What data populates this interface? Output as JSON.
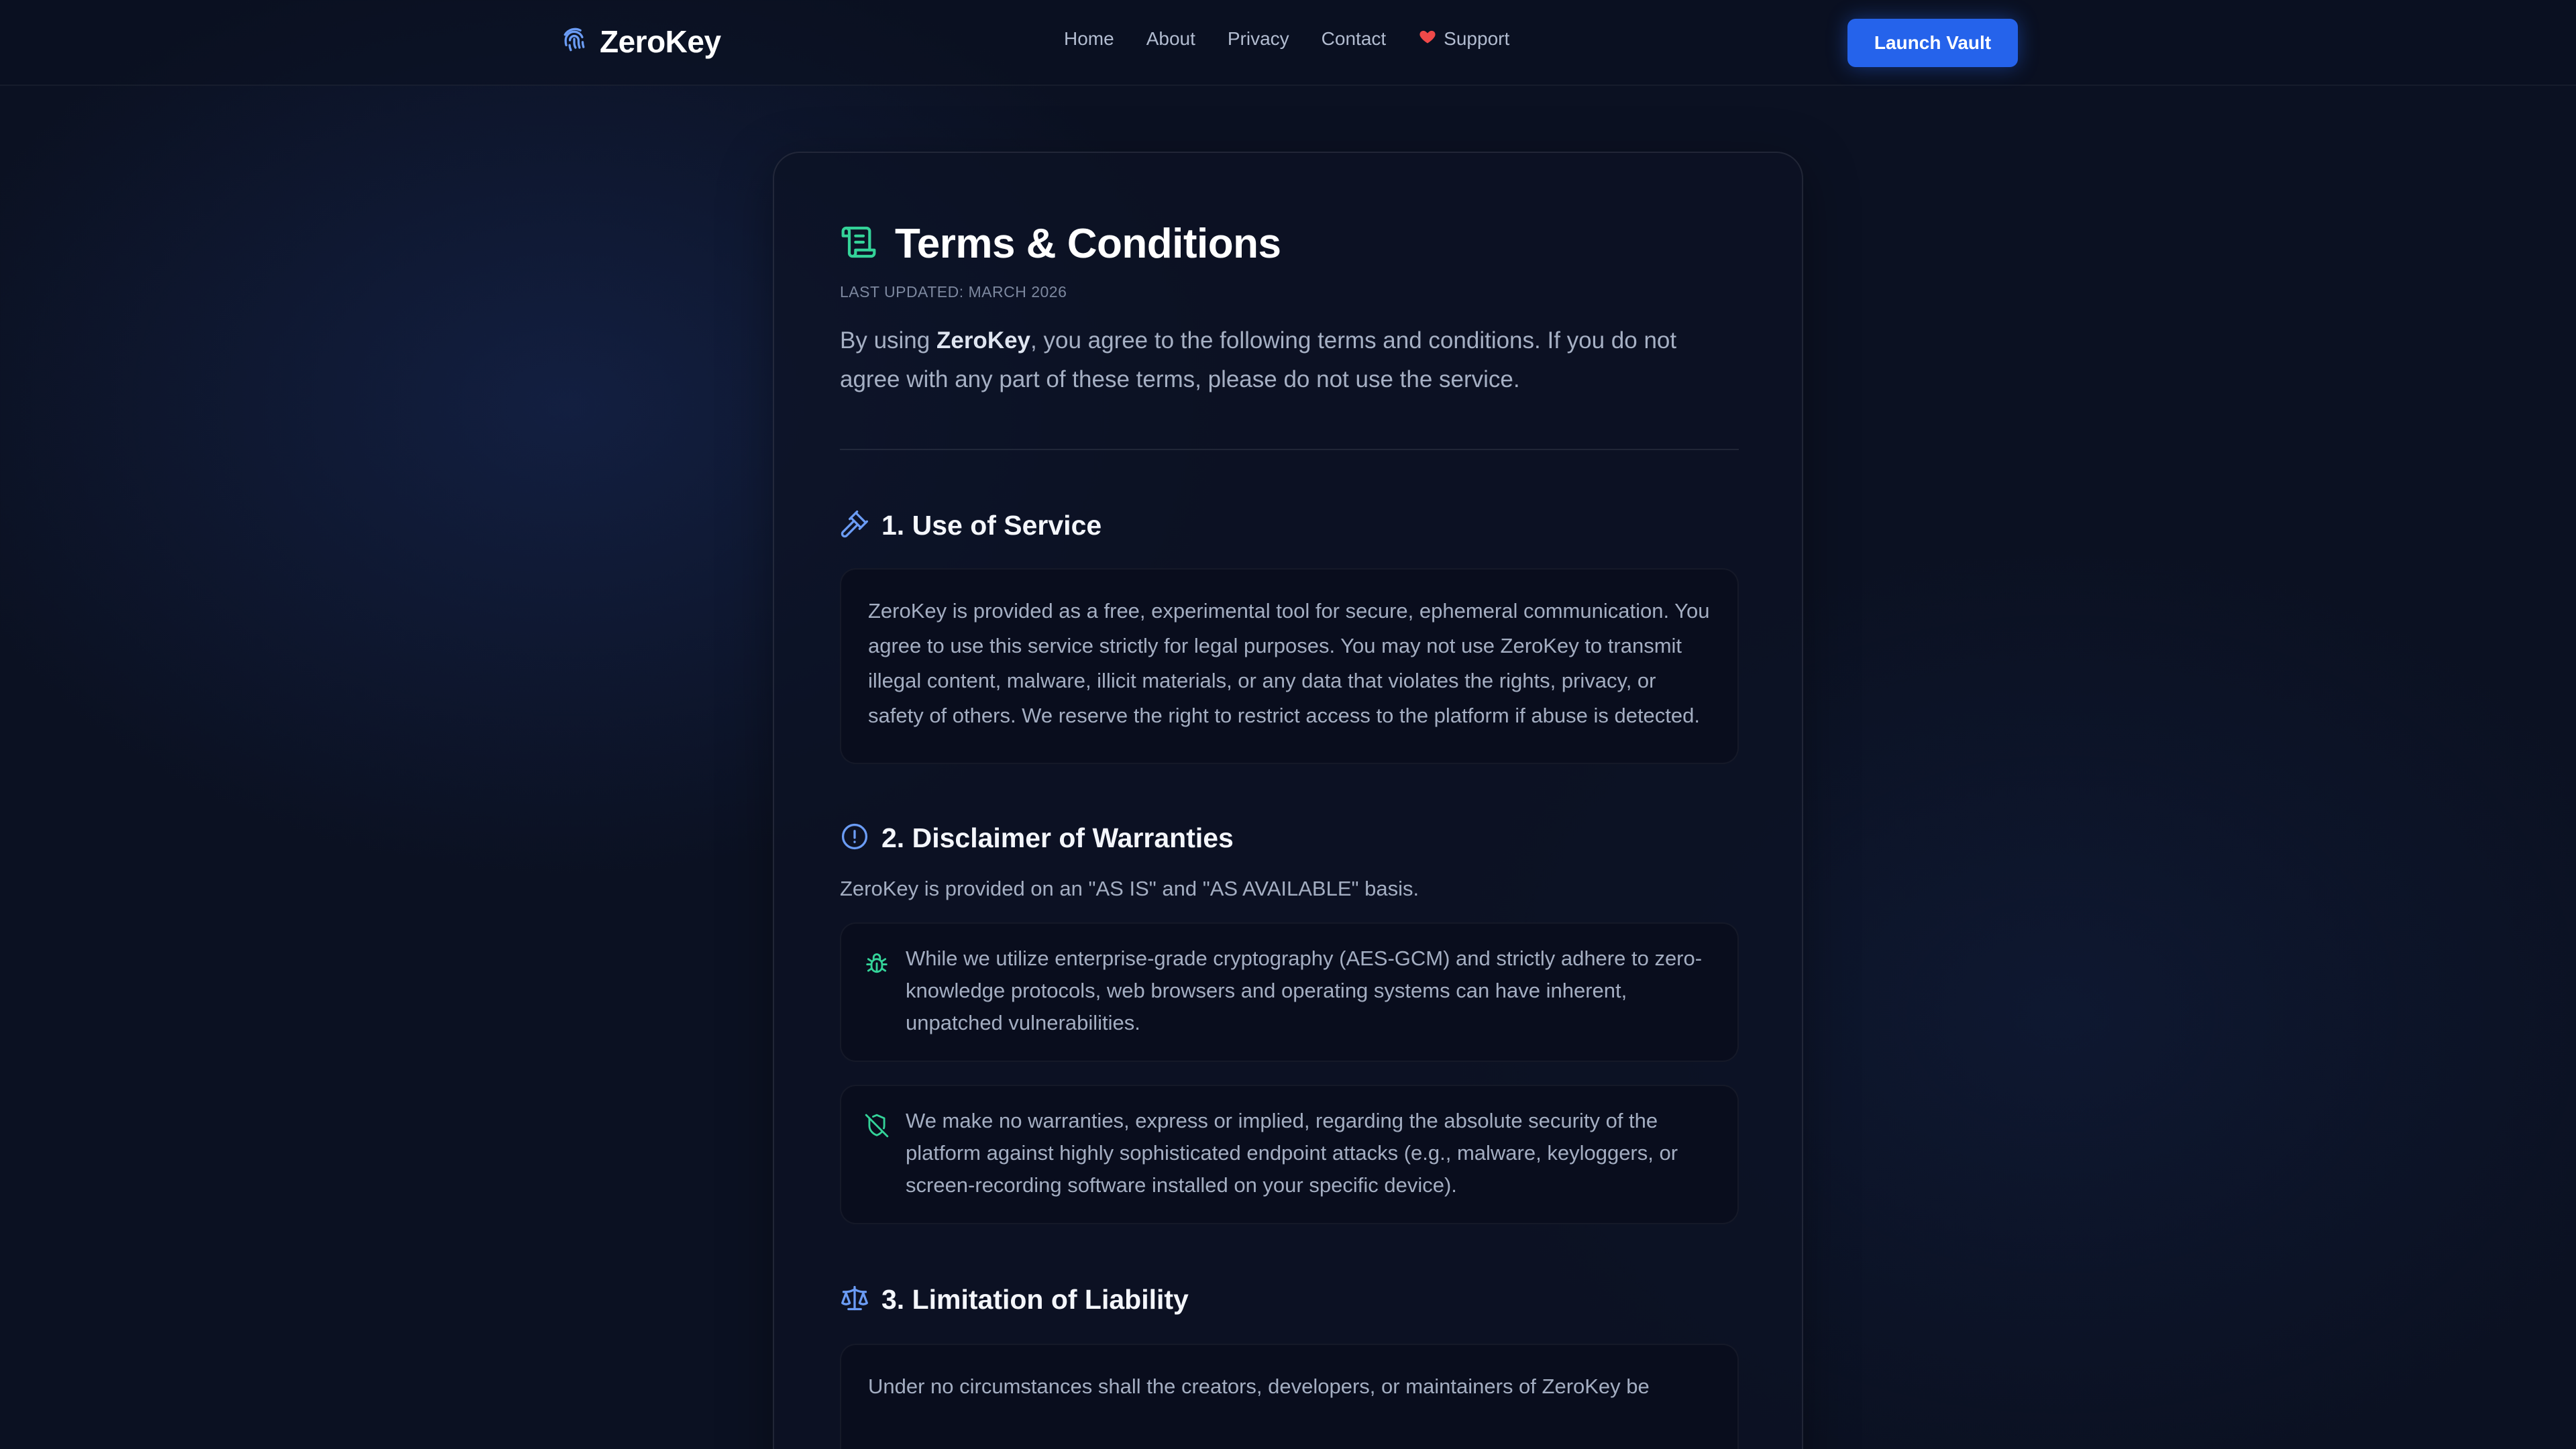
{
  "nav": {
    "brand": "ZeroKey",
    "links": [
      "Home",
      "About",
      "Privacy",
      "Contact"
    ],
    "support_label": "Support",
    "cta_label": "Launch Vault"
  },
  "page": {
    "title": "Terms & Conditions",
    "updated": "LAST UPDATED: MARCH 2026",
    "intro_before": "By using ",
    "intro_brand": "ZeroKey",
    "intro_after": ", you agree to the following terms and conditions. If you do not agree with any part of these terms, please do not use the service."
  },
  "sections": {
    "use": {
      "title": "1. Use of Service",
      "body": "ZeroKey is provided as a free, experimental tool for secure, ephemeral communication. You agree to use this service strictly for legal purposes. You may not use ZeroKey to transmit illegal content, malware, illicit materials, or any data that violates the rights, privacy, or safety of others. We reserve the right to restrict access to the platform if abuse is detected."
    },
    "disclaimer": {
      "title": "2. Disclaimer of Warranties",
      "lead": "ZeroKey is provided on an \"AS IS\" and \"AS AVAILABLE\" basis.",
      "point1": "While we utilize enterprise-grade cryptography (AES-GCM) and strictly adhere to zero-knowledge protocols, web browsers and operating systems can have inherent, unpatched vulnerabilities.",
      "point2": "We make no warranties, express or implied, regarding the absolute security of the platform against highly sophisticated endpoint attacks (e.g., malware, keyloggers, or screen-recording software installed on your specific device)."
    },
    "liability": {
      "title": "3. Limitation of Liability",
      "body": "Under no circumstances shall the creators, developers, or maintainers of ZeroKey be"
    }
  },
  "icons": {
    "brand": "fingerprint-icon",
    "support": "heart-icon",
    "title": "scroll-icon",
    "use": "gavel-icon",
    "disclaimer": "alert-circle-icon",
    "point1": "bug-icon",
    "point2": "shield-off-icon",
    "liability": "scale-icon"
  },
  "colors": {
    "accent": "#2563eb",
    "icon_blue": "#6b9cf5",
    "icon_green": "#34d399",
    "heart": "#f04949"
  }
}
